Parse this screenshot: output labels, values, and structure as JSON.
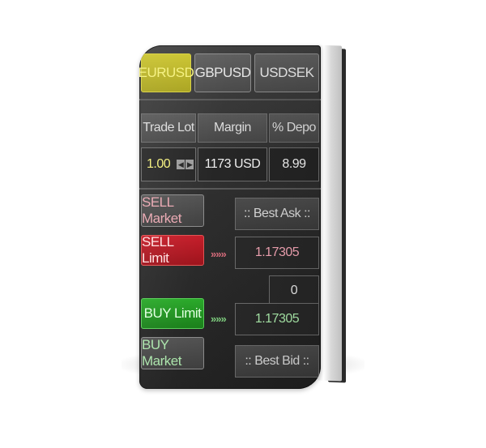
{
  "tabs": [
    {
      "label": "EURUSD",
      "active": true
    },
    {
      "label": "GBPUSD",
      "active": false
    },
    {
      "label": "USDSEK",
      "active": false
    }
  ],
  "table": {
    "headers": [
      "Trade Lot",
      "Margin",
      "% Depo"
    ],
    "lot": "1.00",
    "margin": "1173 USD",
    "depo": "8.99"
  },
  "buttons": {
    "sell_market": "SELL Market",
    "sell_limit": "SELL Limit",
    "buy_limit": "BUY Limit",
    "buy_market": "BUY Market"
  },
  "prices": {
    "best_ask": ":: Best Ask ::",
    "sell_limit_price": "1.17305",
    "spread": "0",
    "buy_limit_price": "1.17305",
    "best_bid": ":: Best Bid ::"
  },
  "arrows": {
    "sell": "»»»",
    "buy": "»»»"
  },
  "colors": {
    "active_tab": "#c9c228",
    "sell_limit": "#b3121c",
    "buy_limit": "#1f9a1f",
    "sell_market_text": "#e9a6b0",
    "buy_market_text": "#a9e3a9",
    "sell_price_text": "#f2a3b3",
    "buy_price_text": "#a9e9a9",
    "lot_text": "#f4f07a"
  }
}
